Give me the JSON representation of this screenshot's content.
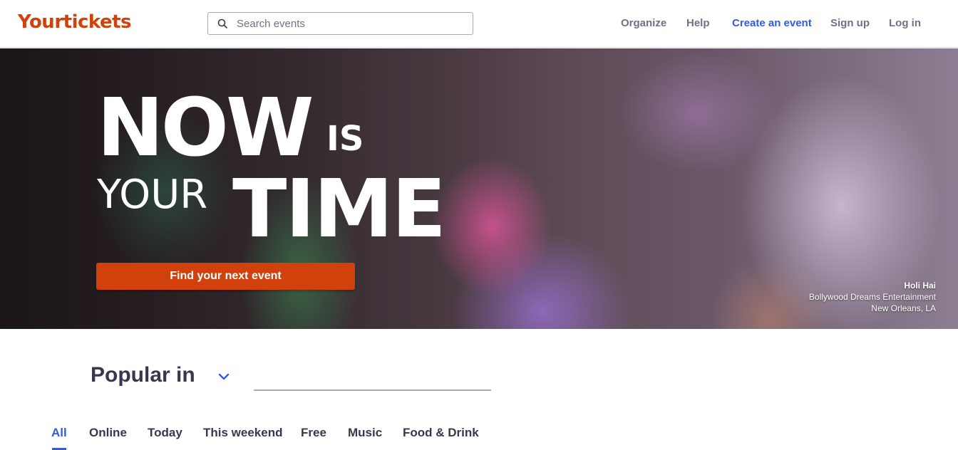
{
  "header": {
    "logo": "Yourtickets",
    "search": {
      "placeholder": "Search events",
      "value": ""
    },
    "nav": [
      "Organize",
      "Help",
      "Create an event",
      "Sign up",
      "Log in"
    ]
  },
  "hero": {
    "headline": {
      "word1": "NOW",
      "word2": "IS",
      "word3": "YOUR",
      "word4": "TIME"
    },
    "cta_label": "Find your next event",
    "credit": {
      "event": "Holi Hai",
      "organizer": "Bollywood Dreams Entertainment",
      "location": "New Orleans, LA"
    }
  },
  "popular": {
    "label": "Popular in",
    "location_value": "",
    "tabs": [
      "All",
      "Online",
      "Today",
      "This weekend",
      "Free",
      "Music",
      "Food & Drink"
    ],
    "active_tab": "All"
  },
  "colors": {
    "brand": "#d1410c",
    "accent": "#3659e3",
    "text": "#39364f",
    "muted": "#6f7287"
  },
  "icons": {
    "search": "search-icon",
    "chevron": "chevron-down-icon"
  }
}
